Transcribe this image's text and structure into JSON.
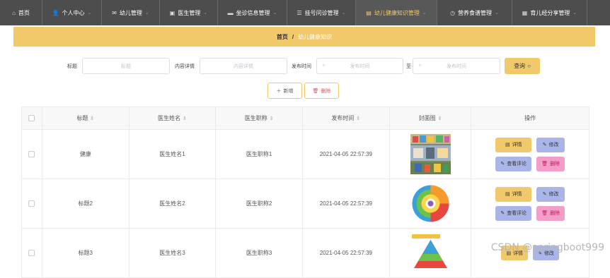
{
  "nav": [
    {
      "label": "首页",
      "icon": "home-icon",
      "active": false,
      "chevron": false
    },
    {
      "label": "个人中心",
      "icon": "user-icon",
      "active": false,
      "chevron": true
    },
    {
      "label": "幼儿管理",
      "icon": "mail-icon",
      "active": false,
      "chevron": true
    },
    {
      "label": "医生管理",
      "icon": "doctor-icon",
      "active": false,
      "chevron": true
    },
    {
      "label": "坐诊信息管理",
      "icon": "monitor-icon",
      "active": false,
      "chevron": true
    },
    {
      "label": "挂号问诊管理",
      "icon": "list-icon",
      "active": false,
      "chevron": true
    },
    {
      "label": "幼儿健康知识管理",
      "icon": "chat-icon",
      "active": true,
      "chevron": true
    },
    {
      "label": "营养食谱管理",
      "icon": "clock-icon",
      "active": false,
      "chevron": true
    },
    {
      "label": "育儿经分享管理",
      "icon": "grid-icon",
      "active": false,
      "chevron": true
    }
  ],
  "breadcrumb": {
    "home": "首页",
    "separator": "/",
    "current": "幼儿健康知识"
  },
  "search": {
    "title_label": "标题",
    "title_placeholder": "标题",
    "content_label": "内容详情",
    "content_placeholder": "内容详情",
    "time_label": "发布时间",
    "time_start_placeholder": "发布时间",
    "to_label": "至",
    "time_end_placeholder": "发布时间",
    "button_label": "查询"
  },
  "toolbar": {
    "add_label": "新增",
    "delete_label": "删除"
  },
  "table": {
    "headers": [
      "标题",
      "医生姓名",
      "医生职称",
      "发布时间",
      "封面图",
      "操作"
    ],
    "rows": [
      {
        "title": "健康",
        "doctor": "医生姓名1",
        "rank": "医生职称1",
        "time": "2021-04-05 22:57:39"
      },
      {
        "title": "标题2",
        "doctor": "医生姓名2",
        "rank": "医生职称2",
        "time": "2021-04-05 22:57:39"
      },
      {
        "title": "标题3",
        "doctor": "医生姓名3",
        "rank": "医生职称3",
        "time": "2021-04-05 22:57:39"
      }
    ],
    "actions": {
      "detail": "详情",
      "edit": "修改",
      "comment": "查看评论",
      "remove": "删除"
    }
  },
  "watermark": "CSDN @springboot999",
  "colors": {
    "nav_bg": "#4d4d4d",
    "accent": "#f1c86a",
    "edit": "#a9b4e8",
    "remove": "#f29ec8"
  }
}
